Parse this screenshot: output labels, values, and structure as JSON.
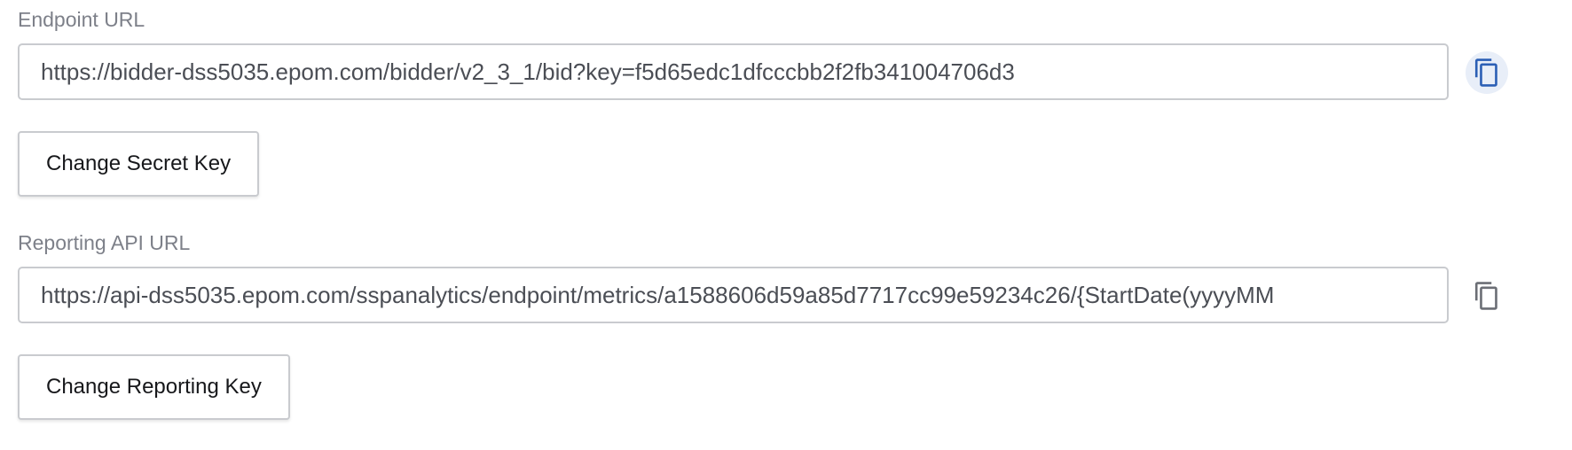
{
  "endpoint": {
    "label": "Endpoint URL",
    "value": "https://bidder-dss5035.epom.com/bidder/v2_3_1/bid?key=f5d65edc1dfcccbb2f2fb341004706d3",
    "copy_icon": "copy-icon",
    "copy_icon_color": "#2b5fb5",
    "button_label": "Change Secret Key"
  },
  "reporting": {
    "label": "Reporting API URL",
    "value": "https://api-dss5035.epom.com/sspanalytics/endpoint/metrics/a1588606d59a85d7717cc99e59234c26/{StartDate(yyyyMM",
    "copy_icon": "copy-icon",
    "copy_icon_color": "#6b6e75",
    "button_label": "Change Reporting Key"
  }
}
